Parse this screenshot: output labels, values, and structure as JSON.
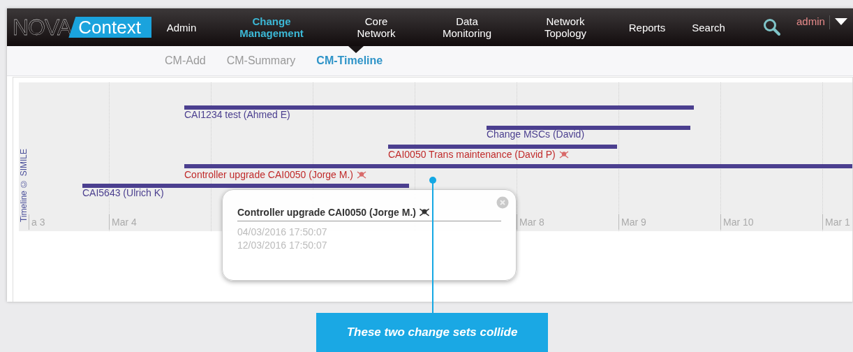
{
  "logo": {
    "primary": "NOVA",
    "secondary": "Context"
  },
  "nav": [
    {
      "label": "Admin",
      "selected": false
    },
    {
      "label": "Change Management",
      "selected": true
    },
    {
      "label": "Core Network",
      "selected": false
    },
    {
      "label": "Data Monitoring",
      "selected": false
    },
    {
      "label": "Network Topology",
      "selected": false
    },
    {
      "label": "Reports",
      "selected": false
    },
    {
      "label": "Search",
      "selected": false
    }
  ],
  "user": {
    "name": "admin"
  },
  "subtabs": [
    {
      "label": "CM-Add",
      "selected": false
    },
    {
      "label": "CM-Summary",
      "selected": false
    },
    {
      "label": "CM-Timeline",
      "selected": true
    }
  ],
  "timeline": {
    "credit": "Timeline © SIMILE",
    "ticks_left": [
      {
        "label": "a 3"
      },
      {
        "label": "Mar 4"
      }
    ],
    "ticks_right": [
      {
        "label": "Mar 8"
      },
      {
        "label": "Mar 9"
      },
      {
        "label": "Mar 10"
      },
      {
        "label": "Mar 1"
      }
    ],
    "events": [
      {
        "label": "CAI1234 test (Ahmed E)",
        "conflict": false
      },
      {
        "label": "Change MSCs (David)",
        "conflict": false
      },
      {
        "label": "CAI0050 Trans maintenance (David P)",
        "conflict": true
      },
      {
        "label": "Controller upgrade CAI0050 (Jorge M.)",
        "conflict": true
      },
      {
        "label": "CAI5643 (Ulrich K)",
        "conflict": false
      }
    ]
  },
  "popup": {
    "title": "Controller upgrade CAI0050 (Jorge M.)",
    "conflict": true,
    "start": "04/03/2016 17:50:07",
    "end": "12/03/2016 17:50:07"
  },
  "callout": {
    "text": "These two change sets collide"
  }
}
